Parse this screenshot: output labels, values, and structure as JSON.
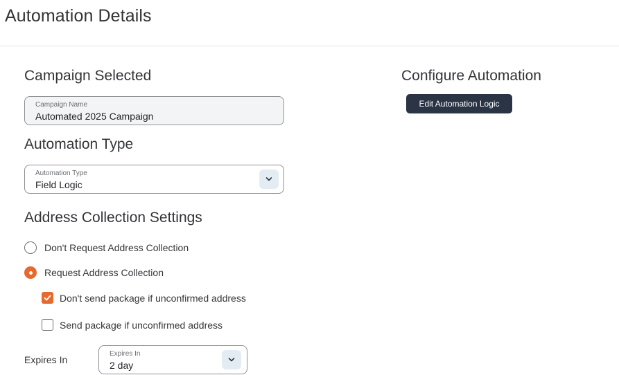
{
  "page": {
    "title": "Automation Details"
  },
  "campaign": {
    "section_title": "Campaign Selected",
    "field_label": "Campaign Name",
    "field_value": "Automated 2025 Campaign"
  },
  "automation_type": {
    "section_title": "Automation Type",
    "field_label": "Automation Type",
    "selected": "Field Logic"
  },
  "address": {
    "section_title": "Address Collection Settings",
    "radios": [
      {
        "label": "Don't Request Address Collection",
        "checked": false
      },
      {
        "label": "Request Address Collection",
        "checked": true
      }
    ],
    "checkboxes": [
      {
        "label": "Don't send package if unconfirmed address",
        "checked": true
      },
      {
        "label": "Send package if unconfirmed address",
        "checked": false
      }
    ],
    "expires": {
      "row_label": "Expires In",
      "field_label": "Expires In",
      "selected": "2 day"
    }
  },
  "configure": {
    "section_title": "Configure Automation",
    "button_label": "Edit Automation Logic"
  },
  "colors": {
    "accent": "#e8692e",
    "button_dark": "#2b3445",
    "dropdown_chevron_bg": "#e4ecf3"
  },
  "icons": {
    "dropdown": "chevron-down-icon",
    "checkmark": "check-icon"
  }
}
